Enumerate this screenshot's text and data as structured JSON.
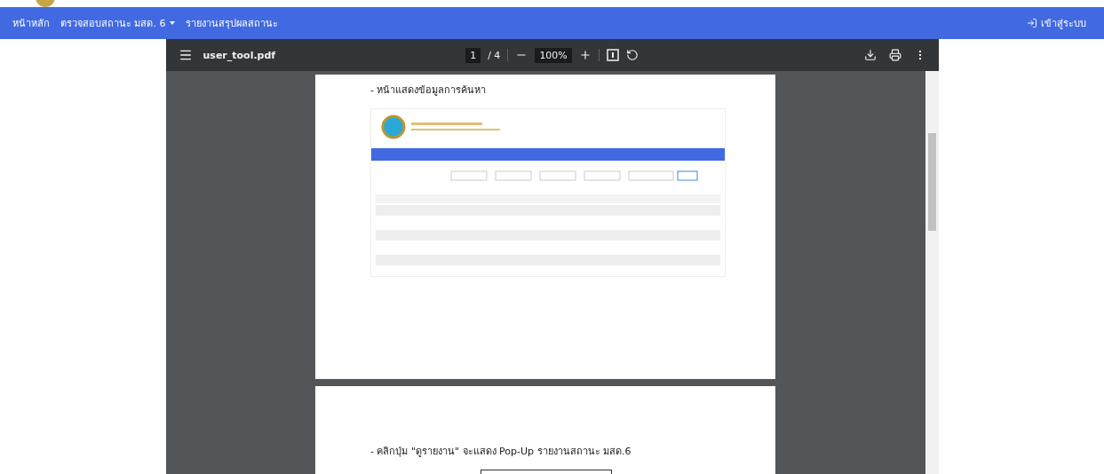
{
  "navbar": {
    "items": [
      {
        "label": "หน้าหลัก",
        "dropdown": false
      },
      {
        "label": "ตรวจสอบสถานะ มสด. 6",
        "dropdown": true
      },
      {
        "label": "รายงานสรุปผลสถานะ",
        "dropdown": false
      }
    ],
    "login": "เข้าสู่ระบบ"
  },
  "pdf_viewer": {
    "file_name": "user_tool.pdf",
    "page_current": "1",
    "page_total": "/ 4",
    "zoom": "100%",
    "pages": [
      {
        "caption": "- หน้าแสดงข้อมูลการค้นหา",
        "kind": "screenshot"
      },
      {
        "caption": "- คลิกปุ่ม \"ดูรายงาน\" จะแสดง Pop-Up รายงานสถานะ มสด.6",
        "kind": "popup"
      }
    ]
  }
}
